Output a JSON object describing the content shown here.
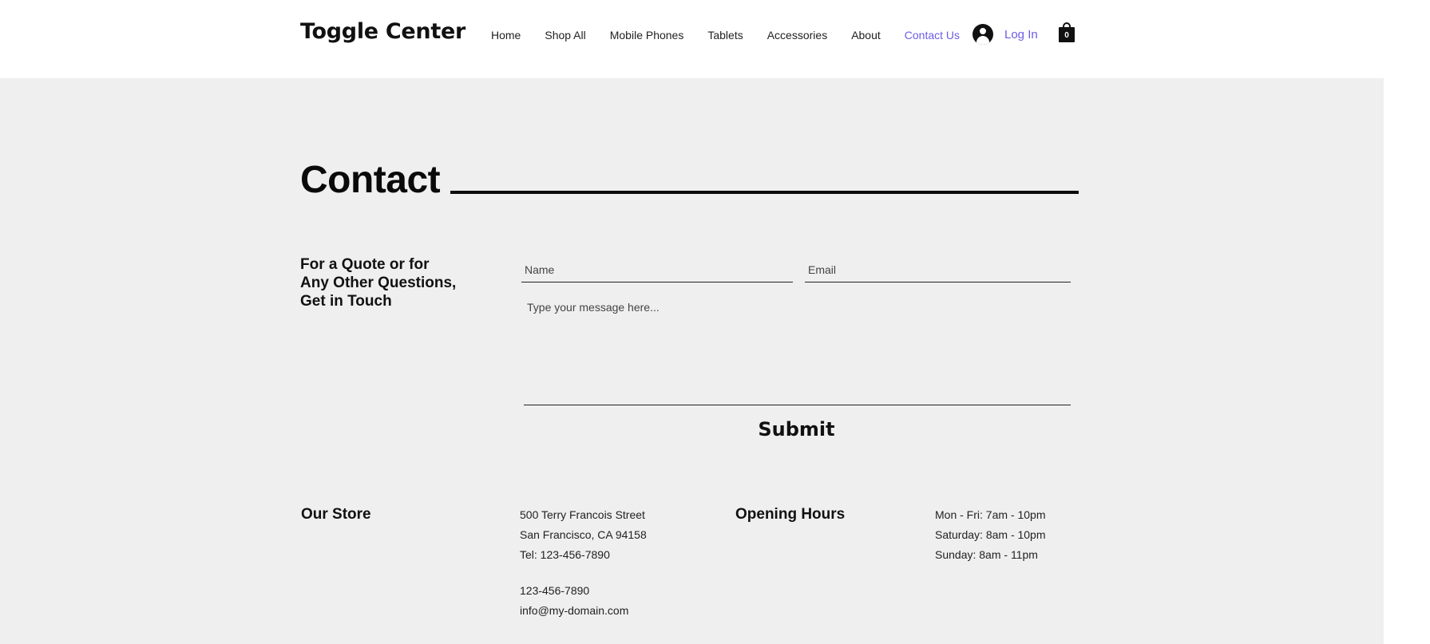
{
  "header": {
    "logo": "Toggle Center",
    "nav": [
      "Home",
      "Shop All",
      "Mobile Phones",
      "Tablets",
      "Accessories",
      "About",
      "Contact Us"
    ],
    "active_nav": "Contact Us",
    "login_label": "Log In",
    "cart_count": "0"
  },
  "contact": {
    "title": "Contact",
    "quote_line1": "For a Quote or for",
    "quote_line2": "Any Other Questions,",
    "quote_line3": "Get in Touch",
    "name_placeholder": "Name",
    "email_placeholder": "Email",
    "message_placeholder": "Type your message here...",
    "submit_label": "Submit"
  },
  "store": {
    "heading": "Our Store",
    "address_line1": "500 Terry Francois Street",
    "address_line2": "San Francisco, CA 94158",
    "tel": "Tel: 123-456-7890",
    "phone": "123-456-7890",
    "email": "info@my-domain.com"
  },
  "hours": {
    "heading": "Opening Hours",
    "weekdays": "Mon - Fri: 7am - 10pm",
    "saturday": "Saturday: 8am - 10pm",
    "sunday": "Sunday: 8am - 11pm"
  },
  "colors": {
    "accent": "#6c5ce7",
    "background": "#efefef",
    "text": "#111111"
  },
  "icons": {
    "account": "avatar-icon",
    "cart": "shopping-bag-icon"
  }
}
